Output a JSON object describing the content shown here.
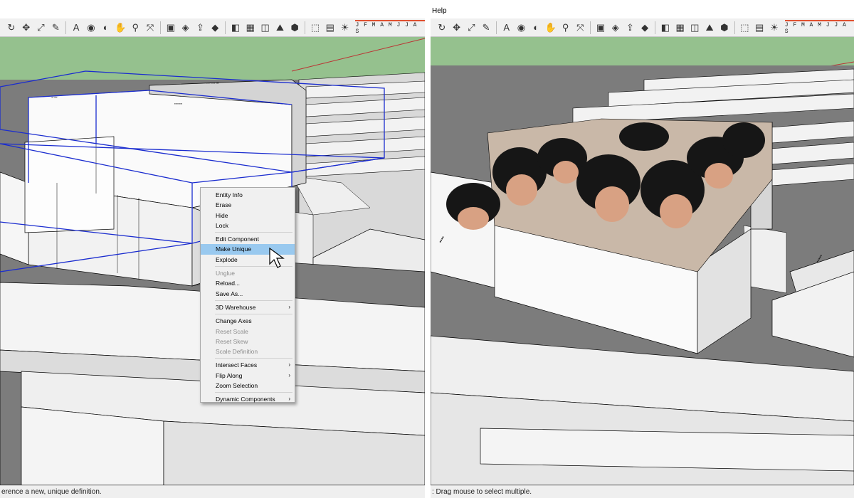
{
  "left": {
    "toolbar": {
      "months": "J F M A M J J A S",
      "icons": [
        "rotate-icon",
        "move-icon",
        "scale-icon",
        "tape-icon",
        "text-icon",
        "paint-icon",
        "orbit-icon",
        "pan-icon",
        "zoom-icon",
        "zoom-extents-icon",
        "warehouse-icon",
        "share-icon",
        "export-icon",
        "ruby-icon",
        "section-icon",
        "shadow-icon",
        "xray-icon",
        "sandbox-icon",
        "iso-icon",
        "top-icon",
        "front-icon",
        "sun-icon"
      ]
    },
    "context_menu": {
      "items": [
        {
          "label": "Entity Info",
          "state": "normal"
        },
        {
          "label": "Erase",
          "state": "normal"
        },
        {
          "label": "Hide",
          "state": "normal"
        },
        {
          "label": "Lock",
          "state": "normal"
        },
        {
          "sep": true
        },
        {
          "label": "Edit Component",
          "state": "normal"
        },
        {
          "label": "Make Unique",
          "state": "highlight"
        },
        {
          "label": "Explode",
          "state": "normal"
        },
        {
          "sep": true
        },
        {
          "label": "Unglue",
          "state": "disabled"
        },
        {
          "label": "Reload...",
          "state": "normal"
        },
        {
          "label": "Save As...",
          "state": "normal"
        },
        {
          "sep": true
        },
        {
          "label": "3D Warehouse",
          "state": "normal",
          "submenu": true
        },
        {
          "sep": true
        },
        {
          "label": "Change Axes",
          "state": "normal"
        },
        {
          "label": "Reset Scale",
          "state": "disabled"
        },
        {
          "label": "Reset Skew",
          "state": "disabled"
        },
        {
          "label": "Scale Definition",
          "state": "disabled"
        },
        {
          "sep": true
        },
        {
          "label": "Intersect Faces",
          "state": "normal",
          "submenu": true
        },
        {
          "label": "Flip Along",
          "state": "normal",
          "submenu": true
        },
        {
          "label": "Zoom Selection",
          "state": "normal"
        },
        {
          "sep": true
        },
        {
          "label": "Dynamic Components",
          "state": "normal",
          "submenu": true
        }
      ],
      "submenu_glyph": "›"
    },
    "status": "erence a new, unique definition."
  },
  "right": {
    "menu": "Help",
    "toolbar": {
      "months": "J F M A M J J A S"
    },
    "status": ": Drag mouse to select multiple."
  },
  "colors": {
    "ground": "#95c18e",
    "shadow": "#7a7a7a",
    "selection": "#1a2ccf",
    "highlight": "#99c9ef"
  }
}
